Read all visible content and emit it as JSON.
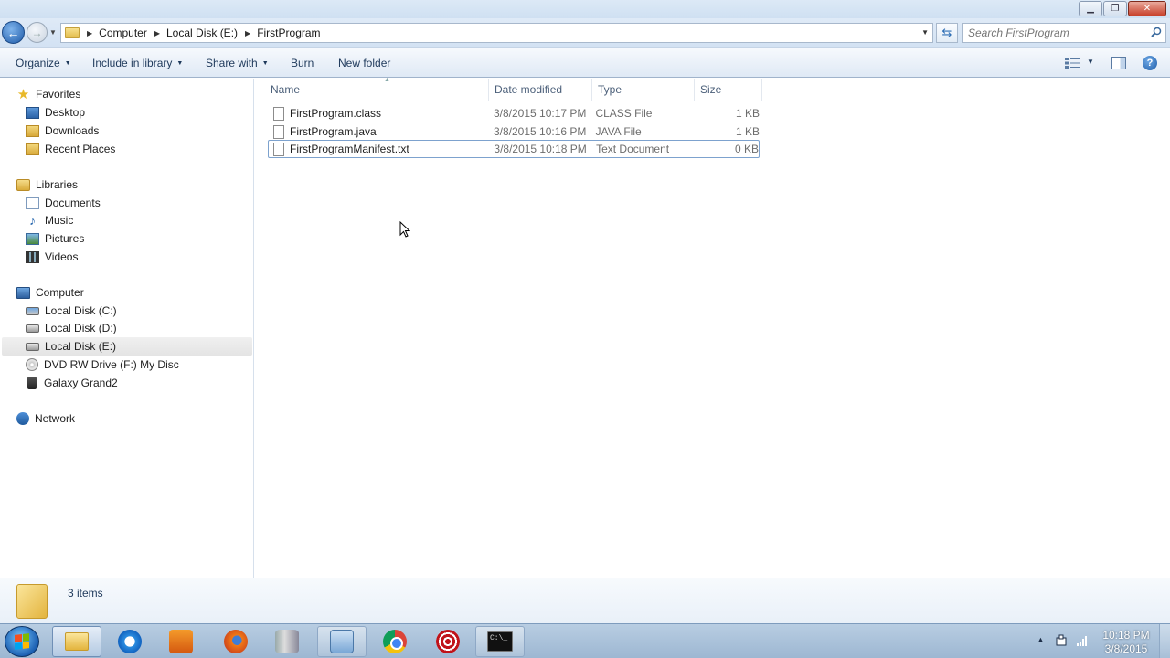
{
  "window": {
    "minimize": "▁",
    "maximize": "❐",
    "close": "✕"
  },
  "address": {
    "crumbs": [
      "Computer",
      "Local Disk (E:)",
      "FirstProgram"
    ],
    "search_placeholder": "Search FirstProgram"
  },
  "toolbar": {
    "organize": "Organize",
    "include_in_library": "Include in library",
    "share_with": "Share with",
    "burn": "Burn",
    "new_folder": "New folder"
  },
  "sidebar": {
    "favorites": {
      "label": "Favorites",
      "items": [
        "Desktop",
        "Downloads",
        "Recent Places"
      ]
    },
    "libraries": {
      "label": "Libraries",
      "items": [
        "Documents",
        "Music",
        "Pictures",
        "Videos"
      ]
    },
    "computer": {
      "label": "Computer",
      "items": [
        "Local Disk (C:)",
        "Local Disk (D:)",
        "Local Disk (E:)",
        "DVD RW Drive (F:) My Disc",
        "Galaxy Grand2"
      ],
      "selected": "Local Disk (E:)"
    },
    "network": {
      "label": "Network"
    }
  },
  "columns": {
    "name": "Name",
    "date_modified": "Date modified",
    "type": "Type",
    "size": "Size"
  },
  "files": [
    {
      "name": "FirstProgram.class",
      "date": "3/8/2015 10:17 PM",
      "type": "CLASS File",
      "size": "1 KB"
    },
    {
      "name": "FirstProgram.java",
      "date": "3/8/2015 10:16 PM",
      "type": "JAVA File",
      "size": "1 KB"
    },
    {
      "name": "FirstProgramManifest.txt",
      "date": "3/8/2015 10:18 PM",
      "type": "Text Document",
      "size": "0 KB"
    }
  ],
  "details": {
    "item_count": "3 items"
  },
  "taskbar": {
    "apps": [
      "windows-explorer",
      "internet-explorer",
      "media-player",
      "firefox",
      "database-tool",
      "network-tool",
      "chrome",
      "target-app",
      "command-prompt"
    ],
    "cmd_glyph": "C:\\_",
    "clock_time": "10:18 PM",
    "clock_date": "3/8/2015"
  },
  "colors": {
    "accent": "#1e395b",
    "selection": "#7da2ce",
    "taskbar": "#9db7d2"
  }
}
